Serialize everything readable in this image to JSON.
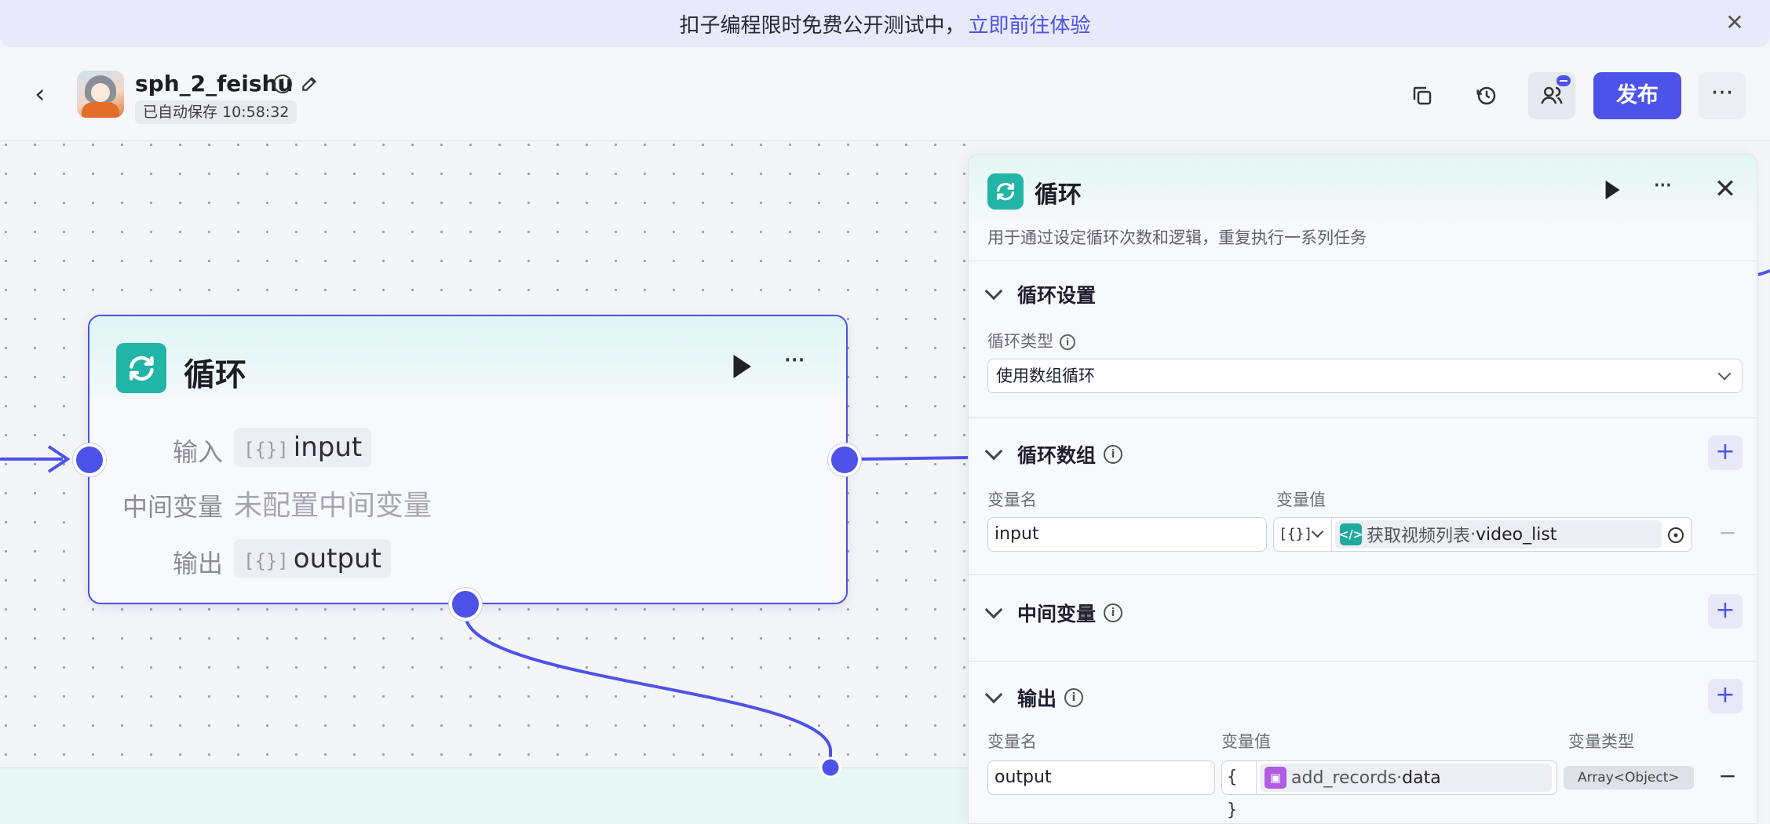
{
  "banner": {
    "text": "扣子编程限时免费公开测试中，",
    "link": "立即前往体验"
  },
  "header": {
    "app_name": "sph_2_feishu",
    "autosave": "已自动保存 10:58:32",
    "publish_label": "发布"
  },
  "node": {
    "title": "循环",
    "input_label": "输入",
    "input_value": "input",
    "middle_label": "中间变量",
    "middle_empty": "未配置中间变量",
    "output_label": "输出",
    "output_value": "output",
    "array_bracket": "[{}]"
  },
  "panel": {
    "title": "循环",
    "description": "用于通过设定循环次数和逻辑，重复执行一系列任务",
    "loop_settings": {
      "title": "循环设置",
      "type_label": "循环类型",
      "type_value": "使用数组循环"
    },
    "loop_array": {
      "title": "循环数组",
      "col_name": "变量名",
      "col_value": "变量值",
      "row": {
        "name": "input",
        "type": "[{}]",
        "ref_node": "获取视频列表",
        "ref_sep": " · ",
        "ref_field": "video_list"
      }
    },
    "middle_vars": {
      "title": "中间变量"
    },
    "output": {
      "title": "输出",
      "col_name": "变量名",
      "col_value": "变量值",
      "col_type": "变量类型",
      "row": {
        "name": "output",
        "type": "{ }",
        "ref_node": "add_records",
        "ref_sep": " · ",
        "ref_field": "data",
        "var_type": "Array<Object>"
      }
    }
  },
  "colors": {
    "accent": "#4d53e8",
    "loop_icon": "#21b5a7",
    "code_icon": "#20a9a1",
    "plugin_icon": "#b05ce3"
  },
  "icons": [
    "back-icon",
    "info-icon",
    "edit-icon",
    "copy-icon",
    "history-icon",
    "collaborator-icon",
    "more-icon",
    "loop-icon",
    "play-icon",
    "close-icon",
    "plus-icon",
    "minus-icon",
    "code-icon",
    "plugin-icon",
    "target-icon"
  ]
}
